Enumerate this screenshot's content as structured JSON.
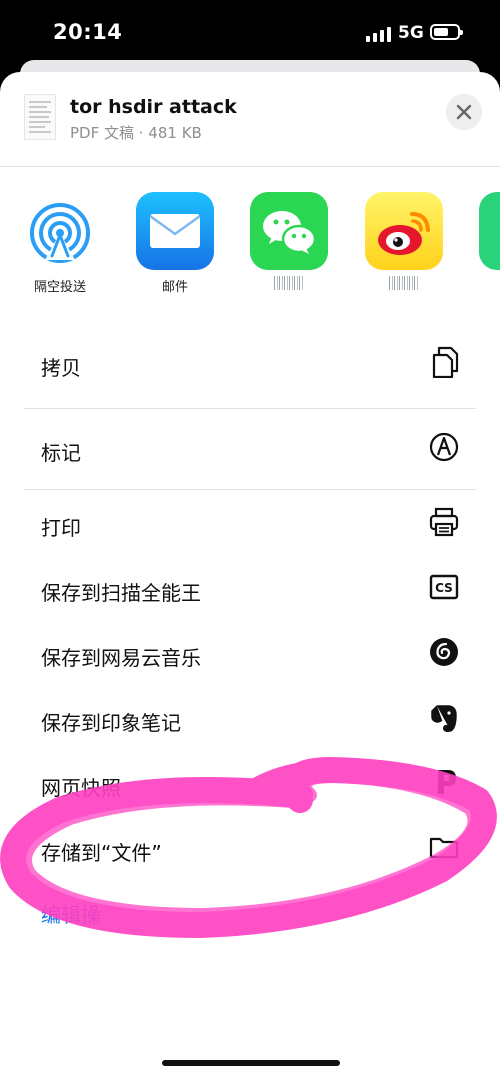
{
  "status_bar": {
    "time": "20:14",
    "network": "5G"
  },
  "document": {
    "title": "tor hsdir attack",
    "meta": "PDF 文稿 · 481 KB"
  },
  "apps": [
    {
      "label": "隔空投送",
      "icon": "airdrop-icon"
    },
    {
      "label": "邮件",
      "icon": "mail-icon"
    },
    {
      "label": "",
      "icon": "wechat-icon"
    },
    {
      "label": "",
      "icon": "weibo-icon"
    }
  ],
  "actions": [
    {
      "label": "拷贝",
      "icon": "copy-icon"
    },
    {
      "label": "标记",
      "icon": "markup-icon"
    },
    {
      "label": "打印",
      "icon": "printer-icon"
    },
    {
      "label": "保存到扫描全能王",
      "icon": "camscanner-icon"
    },
    {
      "label": "保存到网易云音乐",
      "icon": "netease-music-icon"
    },
    {
      "label": "保存到印象笔记",
      "icon": "evernote-icon"
    },
    {
      "label": "网页快照",
      "icon": "snapshot-icon"
    },
    {
      "label": "存储到“文件”",
      "icon": "folder-icon"
    }
  ],
  "edit_actions_label": "编辑操",
  "colors": {
    "link": "#1a73e8",
    "highlight": "#ff3fc0"
  }
}
